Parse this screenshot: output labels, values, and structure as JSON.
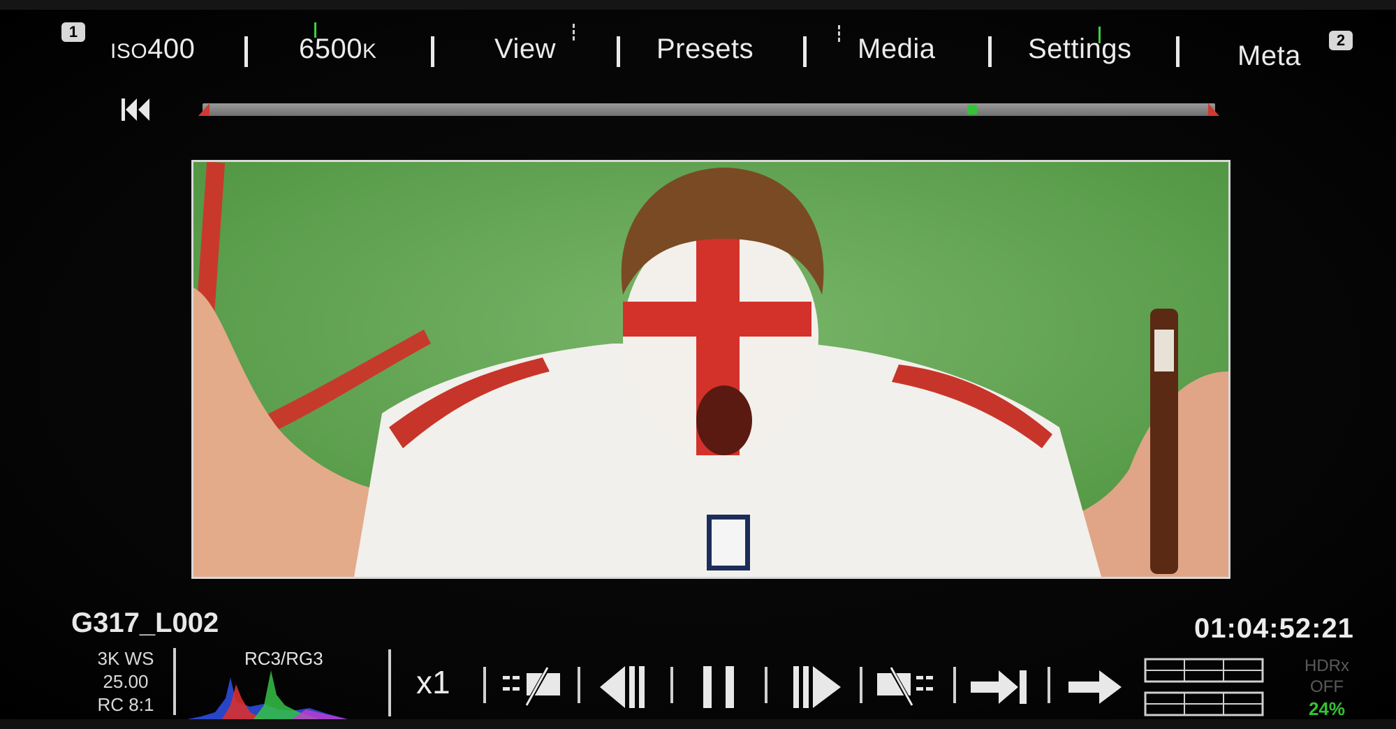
{
  "top_bar": {
    "badge_left": "1",
    "badge_right": "2",
    "iso_prefix": "ISO",
    "iso_value": "400",
    "white_balance": "6500",
    "white_balance_unit": "K",
    "menu": [
      "View",
      "Presets",
      "Media",
      "Settings",
      "Meta"
    ]
  },
  "timeline": {
    "playhead_position": 0.76
  },
  "clip": {
    "name": "G317_L002",
    "timecode": "01:04:52:21",
    "format": "3K WS",
    "fps": "25.00",
    "compression": "RC 8:1",
    "histogram_label": "RC3/RG3"
  },
  "transport": {
    "speed": "x1",
    "buttons": [
      "mark-in-icon",
      "step-back-icon",
      "pause-icon",
      "play-icon",
      "mark-out-icon",
      "go-to-end-icon",
      "forward-icon"
    ]
  },
  "hdrx": {
    "label": "HDRx",
    "state": "OFF",
    "percent": "24%"
  },
  "colors": {
    "accent_green": "#33c433",
    "marker_red": "#d03a2e",
    "background": "#000000",
    "text": "#e6e6e6"
  }
}
